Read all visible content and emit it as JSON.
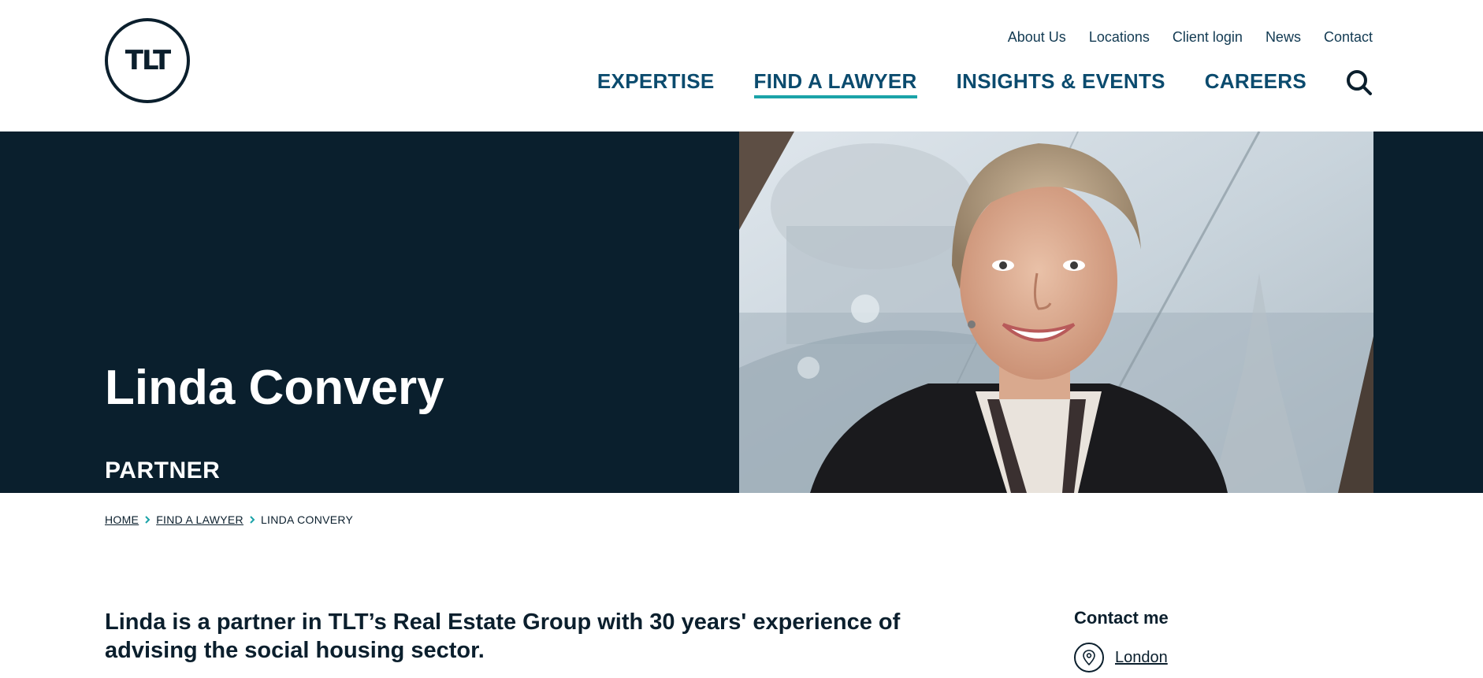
{
  "logo": {
    "text": "TLT"
  },
  "utility_nav": [
    "About Us",
    "Locations",
    "Client login",
    "News",
    "Contact"
  ],
  "main_nav": [
    {
      "label": "EXPERTISE",
      "active": false
    },
    {
      "label": "FIND A LAWYER",
      "active": true
    },
    {
      "label": "INSIGHTS & EVENTS",
      "active": false
    },
    {
      "label": "CAREERS",
      "active": false
    }
  ],
  "hero": {
    "name": "Linda Convery",
    "role": "PARTNER"
  },
  "breadcrumb": {
    "home": "HOME",
    "section": "FIND A LAWYER",
    "current": "LINDA CONVERY"
  },
  "intro": "Linda is a partner in TLT’s Real Estate Group with 30 years' experience of advising the social housing sector.",
  "contact": {
    "heading": "Contact me",
    "location": "London"
  },
  "colors": {
    "navy": "#0a1f2d",
    "accent": "#1aa3a8",
    "nav_text": "#0b4b6e"
  }
}
